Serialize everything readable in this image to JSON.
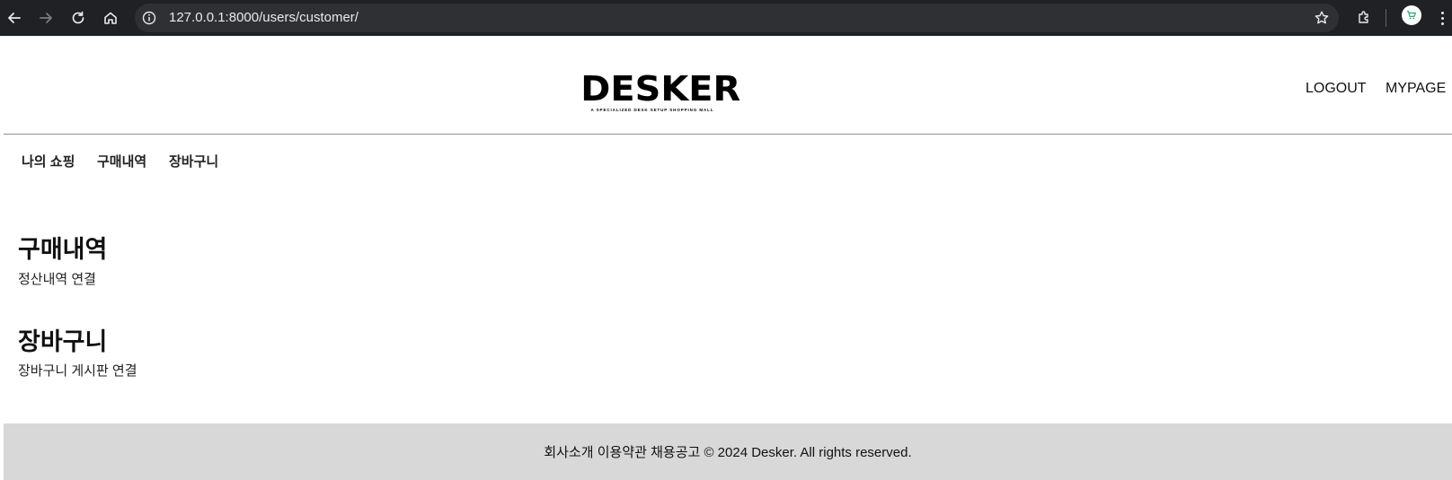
{
  "browser": {
    "url": "127.0.0.1:8000/users/customer/",
    "colors": {
      "chrome_bg": "#202124",
      "omnibox_bg": "#2f3033"
    }
  },
  "header": {
    "logo_text": "DESKER",
    "logo_tagline": "A SPECIALIZED DESK SETUP SHOPPING MALL",
    "logout_label": "LOGOUT",
    "mypage_label": "MYPAGE"
  },
  "subnav": {
    "items": [
      {
        "label": "나의 쇼핑"
      },
      {
        "label": "구매내역"
      },
      {
        "label": "장바구니"
      }
    ]
  },
  "sections": [
    {
      "title": "구매내역",
      "description": "정산내역 연결"
    },
    {
      "title": "장바구니",
      "description": "장바구니 게시판 연결"
    }
  ],
  "footer": {
    "text": "회사소개 이용약관 채용공고 © 2024 Desker. All rights reserved.",
    "bg_color": "#d8d8d8"
  }
}
